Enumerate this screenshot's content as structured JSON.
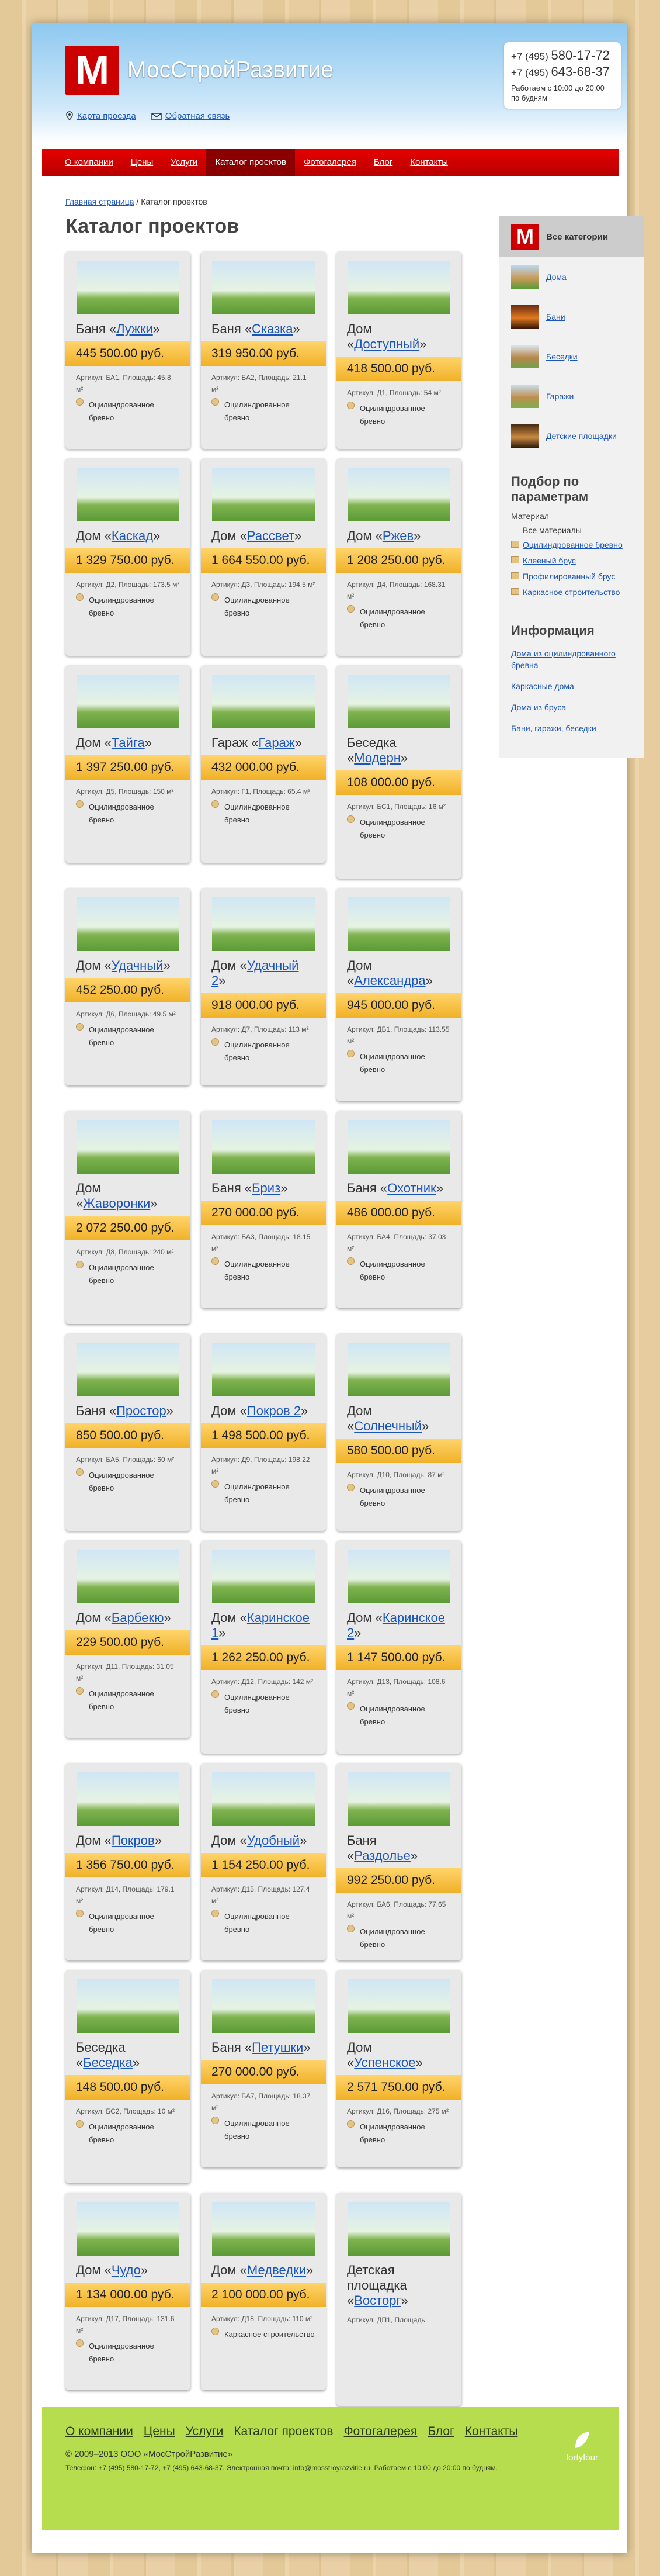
{
  "header": {
    "site_name": "МосСтройРазвитие",
    "phone1_prefix": "+7 (495)",
    "phone1": "580-17-72",
    "phone2_prefix": "+7 (495)",
    "phone2": "643-68-37",
    "hours": "Работаем с 10:00 до 20:00 по будням",
    "map_link": "Карта проезда",
    "feedback_link": "Обратная связь"
  },
  "nav": [
    "О компании",
    "Цены",
    "Услуги",
    "Каталог проектов",
    "Фотогалерея",
    "Блог",
    "Контакты"
  ],
  "breadcrumb": {
    "home": "Главная страница",
    "sep": " / ",
    "current": "Каталог проектов"
  },
  "title": "Каталог проектов",
  "cards": [
    {
      "prefix": "Баня",
      "name": "Лужки",
      "price": "445 500.00 руб.",
      "meta": "Артикул: БА1, Площадь: 45.8 м²",
      "mat": "Оцилиндрованное бревно"
    },
    {
      "prefix": "Баня",
      "name": "Сказка",
      "price": "319 950.00 руб.",
      "meta": "Артикул: БА2, Площадь: 21.1 м²",
      "mat": "Оцилиндрованное бревно"
    },
    {
      "prefix": "Дом",
      "name": "Доступный",
      "price": "418 500.00 руб.",
      "meta": "Артикул: Д1, Площадь: 54 м²",
      "mat": "Оцилиндрованное бревно"
    },
    {
      "prefix": "Дом",
      "name": "Каскад",
      "price": "1 329 750.00 руб.",
      "meta": "Артикул: Д2, Площадь: 173.5 м²",
      "mat": "Оцилиндрованное бревно"
    },
    {
      "prefix": "Дом",
      "name": "Рассвет",
      "price": "1 664 550.00 руб.",
      "meta": "Артикул: Д3, Площадь: 194.5 м²",
      "mat": "Оцилиндрованное бревно"
    },
    {
      "prefix": "Дом",
      "name": "Ржев",
      "price": "1 208 250.00 руб.",
      "meta": "Артикул: Д4, Площадь: 168.31 м²",
      "mat": "Оцилиндрованное бревно"
    },
    {
      "prefix": "Дом",
      "name": "Тайга",
      "price": "1 397 250.00 руб.",
      "meta": "Артикул: Д5, Площадь: 150 м²",
      "mat": "Оцилиндрованное бревно"
    },
    {
      "prefix": "Гараж",
      "name": "Гараж",
      "price": "432 000.00 руб.",
      "meta": "Артикул: Г1, Площадь: 65.4 м²",
      "mat": "Оцилиндрованное бревно"
    },
    {
      "prefix": "Беседка",
      "name": "Модерн",
      "price": "108 000.00 руб.",
      "meta": "Артикул: БС1, Площадь: 16 м²",
      "mat": "Оцилиндрованное бревно"
    },
    {
      "prefix": "Дом",
      "name": "Удачный",
      "price": "452 250.00 руб.",
      "meta": "Артикул: Д6, Площадь: 49.5 м²",
      "mat": "Оцилиндрованное бревно"
    },
    {
      "prefix": "Дом",
      "name": "Удачный 2",
      "price": "918 000.00 руб.",
      "meta": "Артикул: Д7, Площадь: 113 м²",
      "mat": "Оцилиндрованное бревно"
    },
    {
      "prefix": "Дом",
      "name": "Александра",
      "price": "945 000.00 руб.",
      "meta": "Артикул: ДБ1, Площадь: 113.55 м²",
      "mat": "Оцилиндрованное бревно"
    },
    {
      "prefix": "Дом",
      "name": "Жаворонки",
      "price": "2 072 250.00 руб.",
      "meta": "Артикул: Д8, Площадь: 240 м²",
      "mat": "Оцилиндрованное бревно"
    },
    {
      "prefix": "Баня",
      "name": "Бриз",
      "price": "270 000.00 руб.",
      "meta": "Артикул: БА3, Площадь: 18.15 м²",
      "mat": "Оцилиндрованное бревно"
    },
    {
      "prefix": "Баня",
      "name": "Охотник",
      "price": "486 000.00 руб.",
      "meta": "Артикул: БА4, Площадь: 37.03 м²",
      "mat": "Оцилиндрованное бревно"
    },
    {
      "prefix": "Баня",
      "name": "Простор",
      "price": "850 500.00 руб.",
      "meta": "Артикул: БА5, Площадь: 60 м²",
      "mat": "Оцилиндрованное бревно"
    },
    {
      "prefix": "Дом",
      "name": "Покров 2",
      "price": "1 498 500.00 руб.",
      "meta": "Артикул: Д9, Площадь: 198.22 м²",
      "mat": "Оцилиндрованное бревно"
    },
    {
      "prefix": "Дом",
      "name": "Солнечный",
      "price": "580 500.00 руб.",
      "meta": "Артикул: Д10, Площадь: 87 м²",
      "mat": "Оцилиндрованное бревно"
    },
    {
      "prefix": "Дом",
      "name": "Барбекю",
      "price": "229 500.00 руб.",
      "meta": "Артикул: Д11, Площадь: 31.05 м²",
      "mat": "Оцилиндрованное бревно"
    },
    {
      "prefix": "Дом",
      "name": "Каринское 1",
      "price": "1 262 250.00 руб.",
      "meta": "Артикул: Д12, Площадь: 142 м²",
      "mat": "Оцилиндрованное бревно"
    },
    {
      "prefix": "Дом",
      "name": "Каринское 2",
      "price": "1 147 500.00 руб.",
      "meta": "Артикул: Д13, Площадь: 108.6 м²",
      "mat": "Оцилиндрованное бревно"
    },
    {
      "prefix": "Дом",
      "name": "Покров",
      "price": "1 356 750.00 руб.",
      "meta": "Артикул: Д14, Площадь: 179.1 м²",
      "mat": "Оцилиндрованное бревно"
    },
    {
      "prefix": "Дом",
      "name": "Удобный",
      "price": "1 154 250.00 руб.",
      "meta": "Артикул: Д15, Площадь: 127.4 м²",
      "mat": "Оцилиндрованное бревно"
    },
    {
      "prefix": "Баня",
      "name": "Раздолье",
      "price": "992 250.00 руб.",
      "meta": "Артикул: БА6, Площадь: 77.65 м²",
      "mat": "Оцилиндрованное бревно"
    },
    {
      "prefix": "Беседка",
      "name": "Беседка",
      "price": "148 500.00 руб.",
      "meta": "Артикул: БС2, Площадь: 10 м²",
      "mat": "Оцилиндрованное бревно"
    },
    {
      "prefix": "Баня",
      "name": "Петушки",
      "price": "270 000.00 руб.",
      "meta": "Артикул: БА7, Площадь: 18.37 м²",
      "mat": "Оцилиндрованное бревно"
    },
    {
      "prefix": "Дом",
      "name": "Успенское",
      "price": "2 571 750.00 руб.",
      "meta": "Артикул: Д16, Площадь: 275 м²",
      "mat": "Оцилиндрованное бревно"
    },
    {
      "prefix": "Дом",
      "name": "Чудо",
      "price": "1 134 000.00 руб.",
      "meta": "Артикул: Д17, Площадь: 131.6 м²",
      "mat": "Оцилиндрованное бревно"
    },
    {
      "prefix": "Дом",
      "name": "Медведки",
      "price": "2 100 000.00 руб.",
      "meta": "Артикул: Д18, Площадь: 110 м²",
      "mat": "Каркасное строительство"
    },
    {
      "prefix": "Детская площадка",
      "name": "Восторг",
      "price": "",
      "meta": "Артикул: ДП1, Площадь:",
      "mat": ""
    }
  ],
  "sidebar": {
    "all": "Все категории",
    "cats": [
      "Дома",
      "Бани",
      "Беседки",
      "Гаражи",
      "Детские площадки"
    ],
    "filter_title": "Подбор по параметрам",
    "filter_sub": "Материал",
    "filter_all": "Все материалы",
    "filters": [
      "Оцилиндрованное бревно",
      "Клееный брус",
      "Профилированный брус",
      "Каркасное строительство"
    ],
    "info_title": "Информация",
    "info_links": [
      "Дома из оцилиндрованного бревна",
      "Каркасные дома",
      "Дома из бруса",
      "Бани, гаражи, беседки"
    ]
  },
  "footer": {
    "nav": [
      "О компании",
      "Цены",
      "Услуги",
      "Каталог проектов",
      "Фотогалерея",
      "Блог",
      "Контакты"
    ],
    "copy": "© 2009–2013 ООО «МосСтройРазвитие»",
    "info": "Телефон: +7 (495) 580-17-72, +7 (495) 643-68-37. Электронная почта: info@mosstroyrazvitie.ru. Работаем с 10:00 до 20:00 по будням.",
    "brand": "fortyfour"
  }
}
